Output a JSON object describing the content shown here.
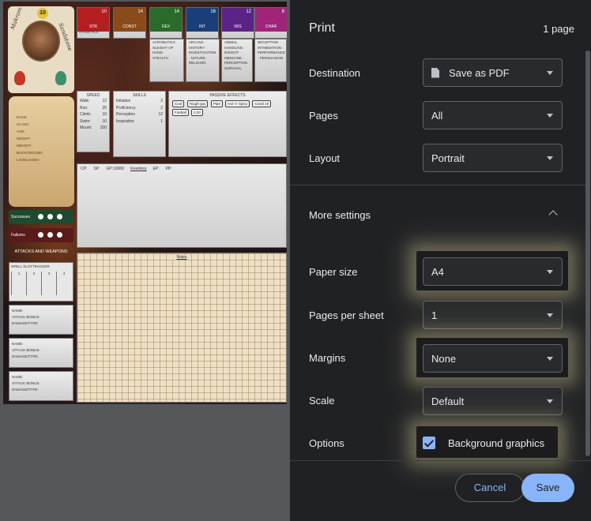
{
  "preview": {
    "character": {
      "level": "10",
      "name_left": "Makram",
      "name_right": "Sandstone"
    },
    "stats": [
      {
        "label": "STR",
        "top": "10",
        "mod": "0",
        "color": "#b31f1f",
        "skills": "ATHLETICS"
      },
      {
        "label": "CONST",
        "top": "14",
        "mod": "+2",
        "color": "#8a4a1a",
        "skills": ""
      },
      {
        "label": "DEX",
        "top": "14",
        "mod": "+2",
        "color": "#2a6a2a",
        "skills": "ACROBATICS · SLEIGHT OF HAND · STEALTH"
      },
      {
        "label": "INT",
        "top": "16",
        "mod": "+3",
        "color": "#1a3f78",
        "skills": "ARCANA · HISTORY · INVESTIGATION · NATURE · RELIGION"
      },
      {
        "label": "WIS",
        "top": "12",
        "mod": "+1",
        "color": "#5b2288",
        "skills": "ANIMAL HANDLING · INSIGHT · MEDICINE · PERCEPTION · SURVIVAL"
      },
      {
        "label": "CHAR",
        "top": "8",
        "mod": "-1",
        "color": "#a0247a",
        "skills": "DECEPTION · INTIMIDATION · PERFORMANCE · PERSUASION"
      }
    ],
    "bio": [
      "Race:",
      "Class:",
      "Age:",
      "Height:",
      "Weight:",
      "Background:",
      "Languages:"
    ],
    "successes_label": "Successes",
    "failures_label": "Failures",
    "speed": {
      "title": "Speed",
      "rows": [
        {
          "k": "Walk:",
          "v": "12"
        },
        {
          "k": "Run:",
          "v": "25"
        },
        {
          "k": "Climb:",
          "v": "10"
        },
        {
          "k": "Swim:",
          "v": "10"
        },
        {
          "k": "Mount:",
          "v": "100"
        }
      ]
    },
    "skills": {
      "title": "Skills",
      "rows": [
        {
          "k": "Initiative",
          "v": "2"
        },
        {
          "k": "Proficiency",
          "v": "2"
        },
        {
          "k": "Perception",
          "v": "12"
        },
        {
          "k": "Inspiration",
          "v": "1"
        }
      ]
    },
    "effects": {
      "title": "Passive Effects",
      "chips": [
        "Cool",
        "Tough guy",
        "Hot 'n' Spicy",
        "Covid 19",
        "Pipe",
        "Fireball",
        "4:20"
      ]
    },
    "inventory": {
      "title": "Inventory",
      "cp": "CP:",
      "sp": "SP:",
      "gp": "GP:",
      "gp_value": "10000",
      "ep": "EP:",
      "pp": "PP:"
    },
    "notes_title": "Notes",
    "attacks_title": "Attacks and Weapons",
    "spell_slots": {
      "title": "Spell slottracker:",
      "levels": [
        "1",
        "2",
        "3",
        "4"
      ]
    },
    "attack_rows": [
      "Name:",
      "Attack Bonus:",
      "Damage/Type:"
    ]
  },
  "print": {
    "title": "Print",
    "page_count": "1 page",
    "destination_label": "Destination",
    "destination_value": "Save as PDF",
    "pages_label": "Pages",
    "pages_value": "All",
    "layout_label": "Layout",
    "layout_value": "Portrait",
    "more_settings_label": "More settings",
    "paper_size_label": "Paper size",
    "paper_size_value": "A4",
    "pages_per_sheet_label": "Pages per sheet",
    "pages_per_sheet_value": "1",
    "margins_label": "Margins",
    "margins_value": "None",
    "scale_label": "Scale",
    "scale_value": "Default",
    "options_label": "Options",
    "background_graphics_label": "Background graphics",
    "background_graphics_checked": true,
    "cancel_label": "Cancel",
    "save_label": "Save"
  },
  "colors": {
    "panel_bg": "#202124",
    "accent": "#8ab4f8",
    "highlight_glow": "#f0e6aa"
  }
}
